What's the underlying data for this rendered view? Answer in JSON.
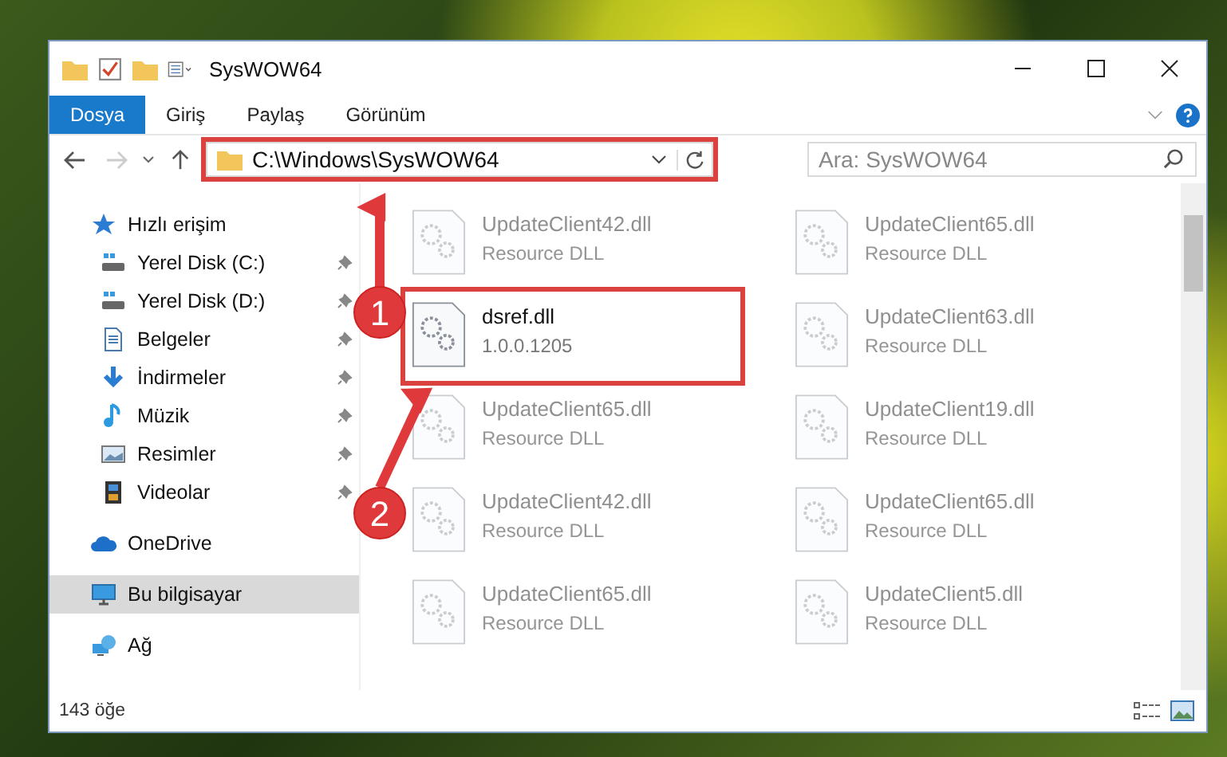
{
  "window": {
    "title": "SysWOW64"
  },
  "ribbon_tabs": [
    {
      "label": "Dosya",
      "selected": true
    },
    {
      "label": "Giriş",
      "selected": false
    },
    {
      "label": "Paylaş",
      "selected": false
    },
    {
      "label": "Görünüm",
      "selected": false
    }
  ],
  "address_bar": {
    "path": "C:\\Windows\\SysWOW64",
    "highlighted": true
  },
  "search": {
    "placeholder": "Ara: SysWOW64"
  },
  "sidebar": {
    "items": [
      {
        "label": "Hızlı erişim",
        "kind": "star",
        "pinned": false,
        "selected": false,
        "children": [
          {
            "label": "Yerel Disk (C:)",
            "kind": "drive",
            "pinned": true,
            "selected": false
          },
          {
            "label": "Yerel Disk (D:)",
            "kind": "drive",
            "pinned": true,
            "selected": false
          },
          {
            "label": "Belgeler",
            "kind": "document",
            "pinned": true,
            "selected": false
          },
          {
            "label": "İndirmeler",
            "kind": "download",
            "pinned": true,
            "selected": false
          },
          {
            "label": "Müzik",
            "kind": "music",
            "pinned": true,
            "selected": false
          },
          {
            "label": "Resimler",
            "kind": "picture",
            "pinned": true,
            "selected": false
          },
          {
            "label": "Videolar",
            "kind": "video",
            "pinned": true,
            "selected": false
          }
        ]
      },
      {
        "label": "OneDrive",
        "kind": "cloud",
        "pinned": false,
        "selected": false
      },
      {
        "label": "Bu bilgisayar",
        "kind": "computer",
        "pinned": false,
        "selected": true
      },
      {
        "label": "Ağ",
        "kind": "network",
        "pinned": false,
        "selected": false
      }
    ]
  },
  "files": [
    {
      "name": "UpdateClient42.dll",
      "detail": "Resource DLL",
      "dimmed": true,
      "highlighted": false
    },
    {
      "name": "UpdateClient65.dll",
      "detail": "Resource DLL",
      "dimmed": true,
      "highlighted": false
    },
    {
      "name": "dsref.dll",
      "detail": "1.0.0.1205",
      "dimmed": false,
      "highlighted": true
    },
    {
      "name": "UpdateClient63.dll",
      "detail": "Resource DLL",
      "dimmed": true,
      "highlighted": false
    },
    {
      "name": "UpdateClient65.dll",
      "detail": "Resource DLL",
      "dimmed": true,
      "highlighted": false
    },
    {
      "name": "UpdateClient19.dll",
      "detail": "Resource DLL",
      "dimmed": true,
      "highlighted": false
    },
    {
      "name": "UpdateClient42.dll",
      "detail": "Resource DLL",
      "dimmed": true,
      "highlighted": false
    },
    {
      "name": "UpdateClient65.dll",
      "detail": "Resource DLL",
      "dimmed": true,
      "highlighted": false
    },
    {
      "name": "UpdateClient65.dll",
      "detail": "Resource DLL",
      "dimmed": true,
      "highlighted": false
    },
    {
      "name": "UpdateClient5.dll",
      "detail": "Resource DLL",
      "dimmed": true,
      "highlighted": false
    }
  ],
  "annotations": [
    {
      "number": "1"
    },
    {
      "number": "2"
    }
  ],
  "status_bar": {
    "count": "143 öğe"
  }
}
